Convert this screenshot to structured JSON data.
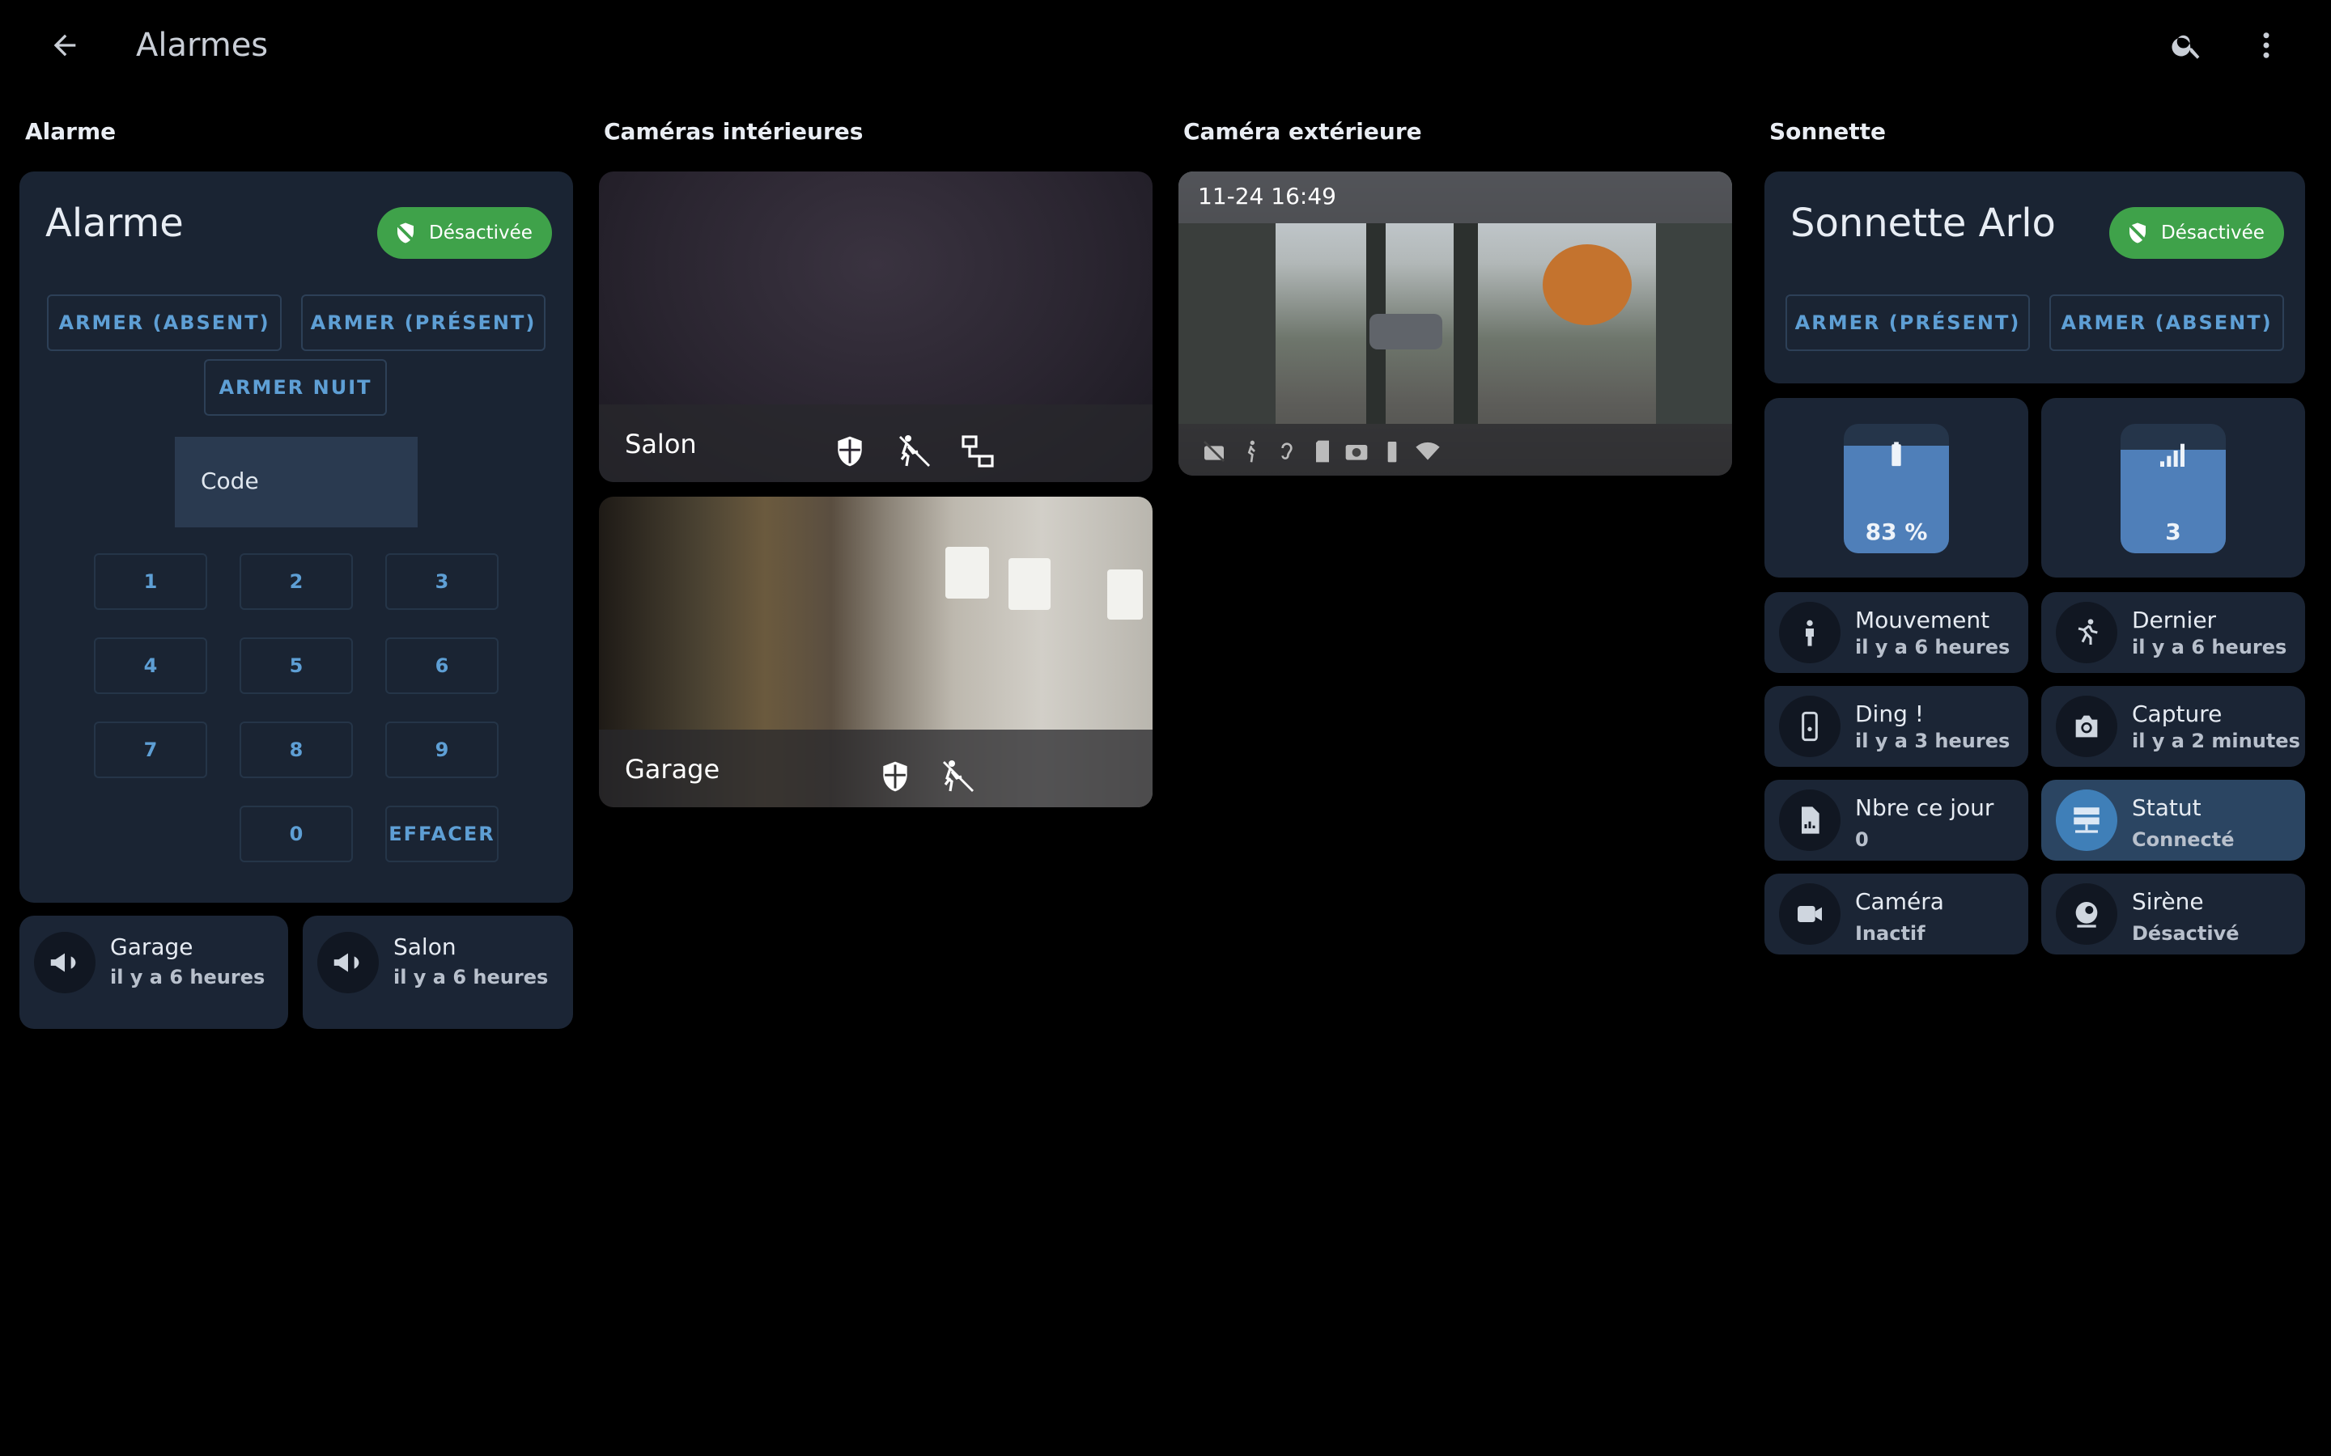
{
  "header": {
    "title": "Alarmes",
    "back_icon": "arrow-left-icon",
    "search_icon": "search-icon",
    "more_icon": "more-vertical-icon"
  },
  "columns": {
    "alarm": "Alarme",
    "indoor": "Caméras intérieures",
    "outdoor": "Caméra extérieure",
    "doorbell": "Sonnette"
  },
  "alarm_panel": {
    "title": "Alarme",
    "status": "Désactivée",
    "arm_away": "ARMER (ABSENT)",
    "arm_home": "ARMER (PRÉSENT)",
    "arm_night": "ARMER NUIT",
    "code_label": "Code",
    "keys": [
      "1",
      "2",
      "3",
      "4",
      "5",
      "6",
      "7",
      "8",
      "9",
      "0"
    ],
    "clear": "EFFACER"
  },
  "sirens": [
    {
      "name": "Garage",
      "state": "il y a 6 heures",
      "icon": "megaphone-icon"
    },
    {
      "name": "Salon",
      "state": "il y a 6 heures",
      "icon": "megaphone-icon"
    }
  ],
  "indoor_cameras": [
    {
      "name": "Salon"
    },
    {
      "name": "Garage"
    }
  ],
  "outdoor_camera": {
    "timestamp": "11-24 16:49"
  },
  "doorbell": {
    "title": "Sonnette Arlo",
    "status": "Désactivée",
    "arm_home": "ARMER (PRÉSENT)",
    "arm_away": "ARMER (ABSENT)",
    "battery": {
      "value": "83 %",
      "level": 0.83
    },
    "signal": {
      "value": "3",
      "level": 0.8
    },
    "tiles": [
      {
        "name": "Mouvement",
        "state": "il y a 6 heures",
        "icon": "motion-sensor-icon"
      },
      {
        "name": "Dernier",
        "state": "il y a 6 heures",
        "icon": "run-icon"
      },
      {
        "name": "Ding !",
        "state": "il y a 3 heures",
        "icon": "doorbell-icon"
      },
      {
        "name": "Capture",
        "state": "il y a 2 minutes",
        "icon": "camera-icon"
      },
      {
        "name": "Nbre ce jour",
        "state": "0",
        "icon": "file-chart-icon"
      },
      {
        "name": "Statut",
        "state": "Connecté",
        "icon": "server-network-icon"
      },
      {
        "name": "Caméra",
        "state": "Inactif",
        "icon": "video-icon"
      },
      {
        "name": "Sirène",
        "state": "Désactivé",
        "icon": "alarm-light-icon"
      }
    ]
  }
}
